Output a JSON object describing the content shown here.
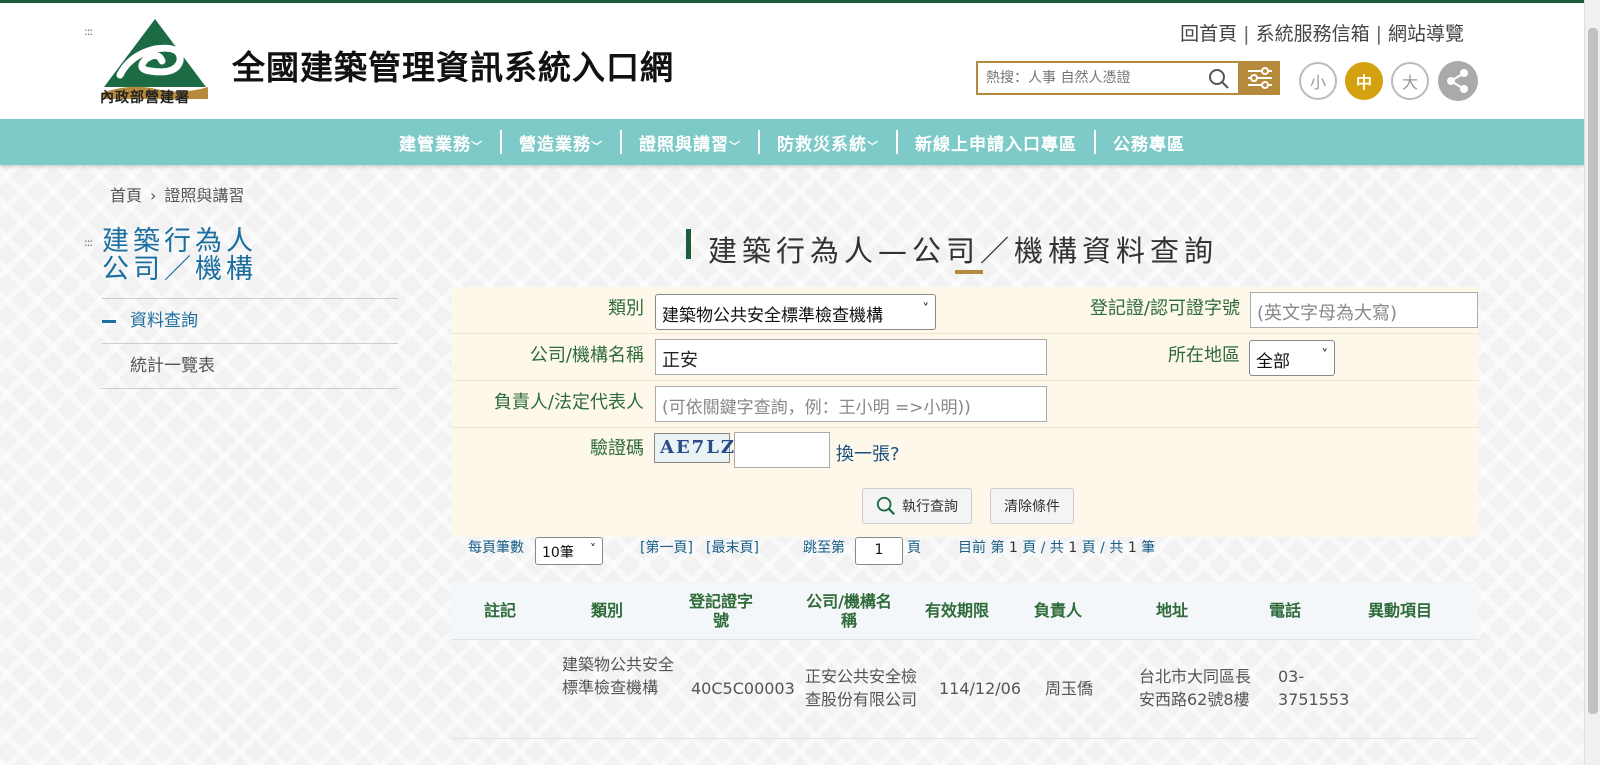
{
  "header": {
    "logo_text": "內政部營建署",
    "site_title": "全國建築管理資訊系統入口網",
    "top_links": [
      "回首頁",
      "系統服務信箱",
      "網站導覽"
    ],
    "search_placeholder": "熱搜：人事 自然人憑證",
    "font_sizes": [
      "小",
      "中",
      "大"
    ],
    "active_font_size": "中"
  },
  "nav": {
    "items": [
      "建管業務",
      "營造業務",
      "證照與講習",
      "防救災系統",
      "新線上申請入口專區",
      "公務專區"
    ]
  },
  "breadcrumb": [
    "首頁",
    "證照與講習"
  ],
  "sidebar": {
    "title_line1": "建築行為人",
    "title_line2": "公司／機構",
    "items": [
      "資料查詢",
      "統計一覽表"
    ]
  },
  "page_title": "建築行為人—公司／機構資料查詢",
  "form": {
    "category_label": "類別",
    "category_value": "建築物公共安全標準檢查機構",
    "cert_label": "登記證/認可證字號",
    "cert_placeholder": "(英文字母為大寫)",
    "name_label": "公司/機構名稱",
    "name_value": "正安",
    "region_label": "所在地區",
    "region_value": "全部",
    "rep_label": "負責人/法定代表人",
    "rep_placeholder": "(可依關鍵字查詢，例：王小明 =>小明))",
    "captcha_label": "驗證碼",
    "captcha_text": "AE7LZ",
    "refresh_label": "換一張?",
    "search_button": "執行查詢",
    "clear_button": "清除條件"
  },
  "pager": {
    "per_page_label": "每頁筆數",
    "per_page_value": "10筆",
    "first_page": "[第一頁]",
    "last_page": "[最末頁]",
    "jump_label": "跳至第",
    "jump_value": "1",
    "page_unit": "頁",
    "status_prefix": "目前 第",
    "current_page": "1",
    "status_mid1": "頁 / 共",
    "total_pages": "1",
    "status_mid2": "頁 / 共",
    "total_records": "1",
    "status_suffix": "筆"
  },
  "table": {
    "headers": [
      "註記",
      "類別",
      "登記證字號",
      "公司/機構名稱",
      "有效期限",
      "負責人",
      "地址",
      "電話",
      "異動項目"
    ],
    "rows": [
      {
        "note": "",
        "category": "建築物公共安全標準檢查機構",
        "cert_no": "40C5C00003",
        "name": "正安公共安全檢查股份有限公司",
        "expiry": "114/12/06",
        "owner": "周玉僑",
        "address": "台北市大同區長安西路62號8樓",
        "phone": "03-3751553",
        "changes": ""
      }
    ]
  },
  "colors": {
    "brand_green": "#1d5d3b",
    "nav_teal": "#7ecac8",
    "gold": "#b58a3a",
    "link_blue": "#1a6fa0"
  }
}
